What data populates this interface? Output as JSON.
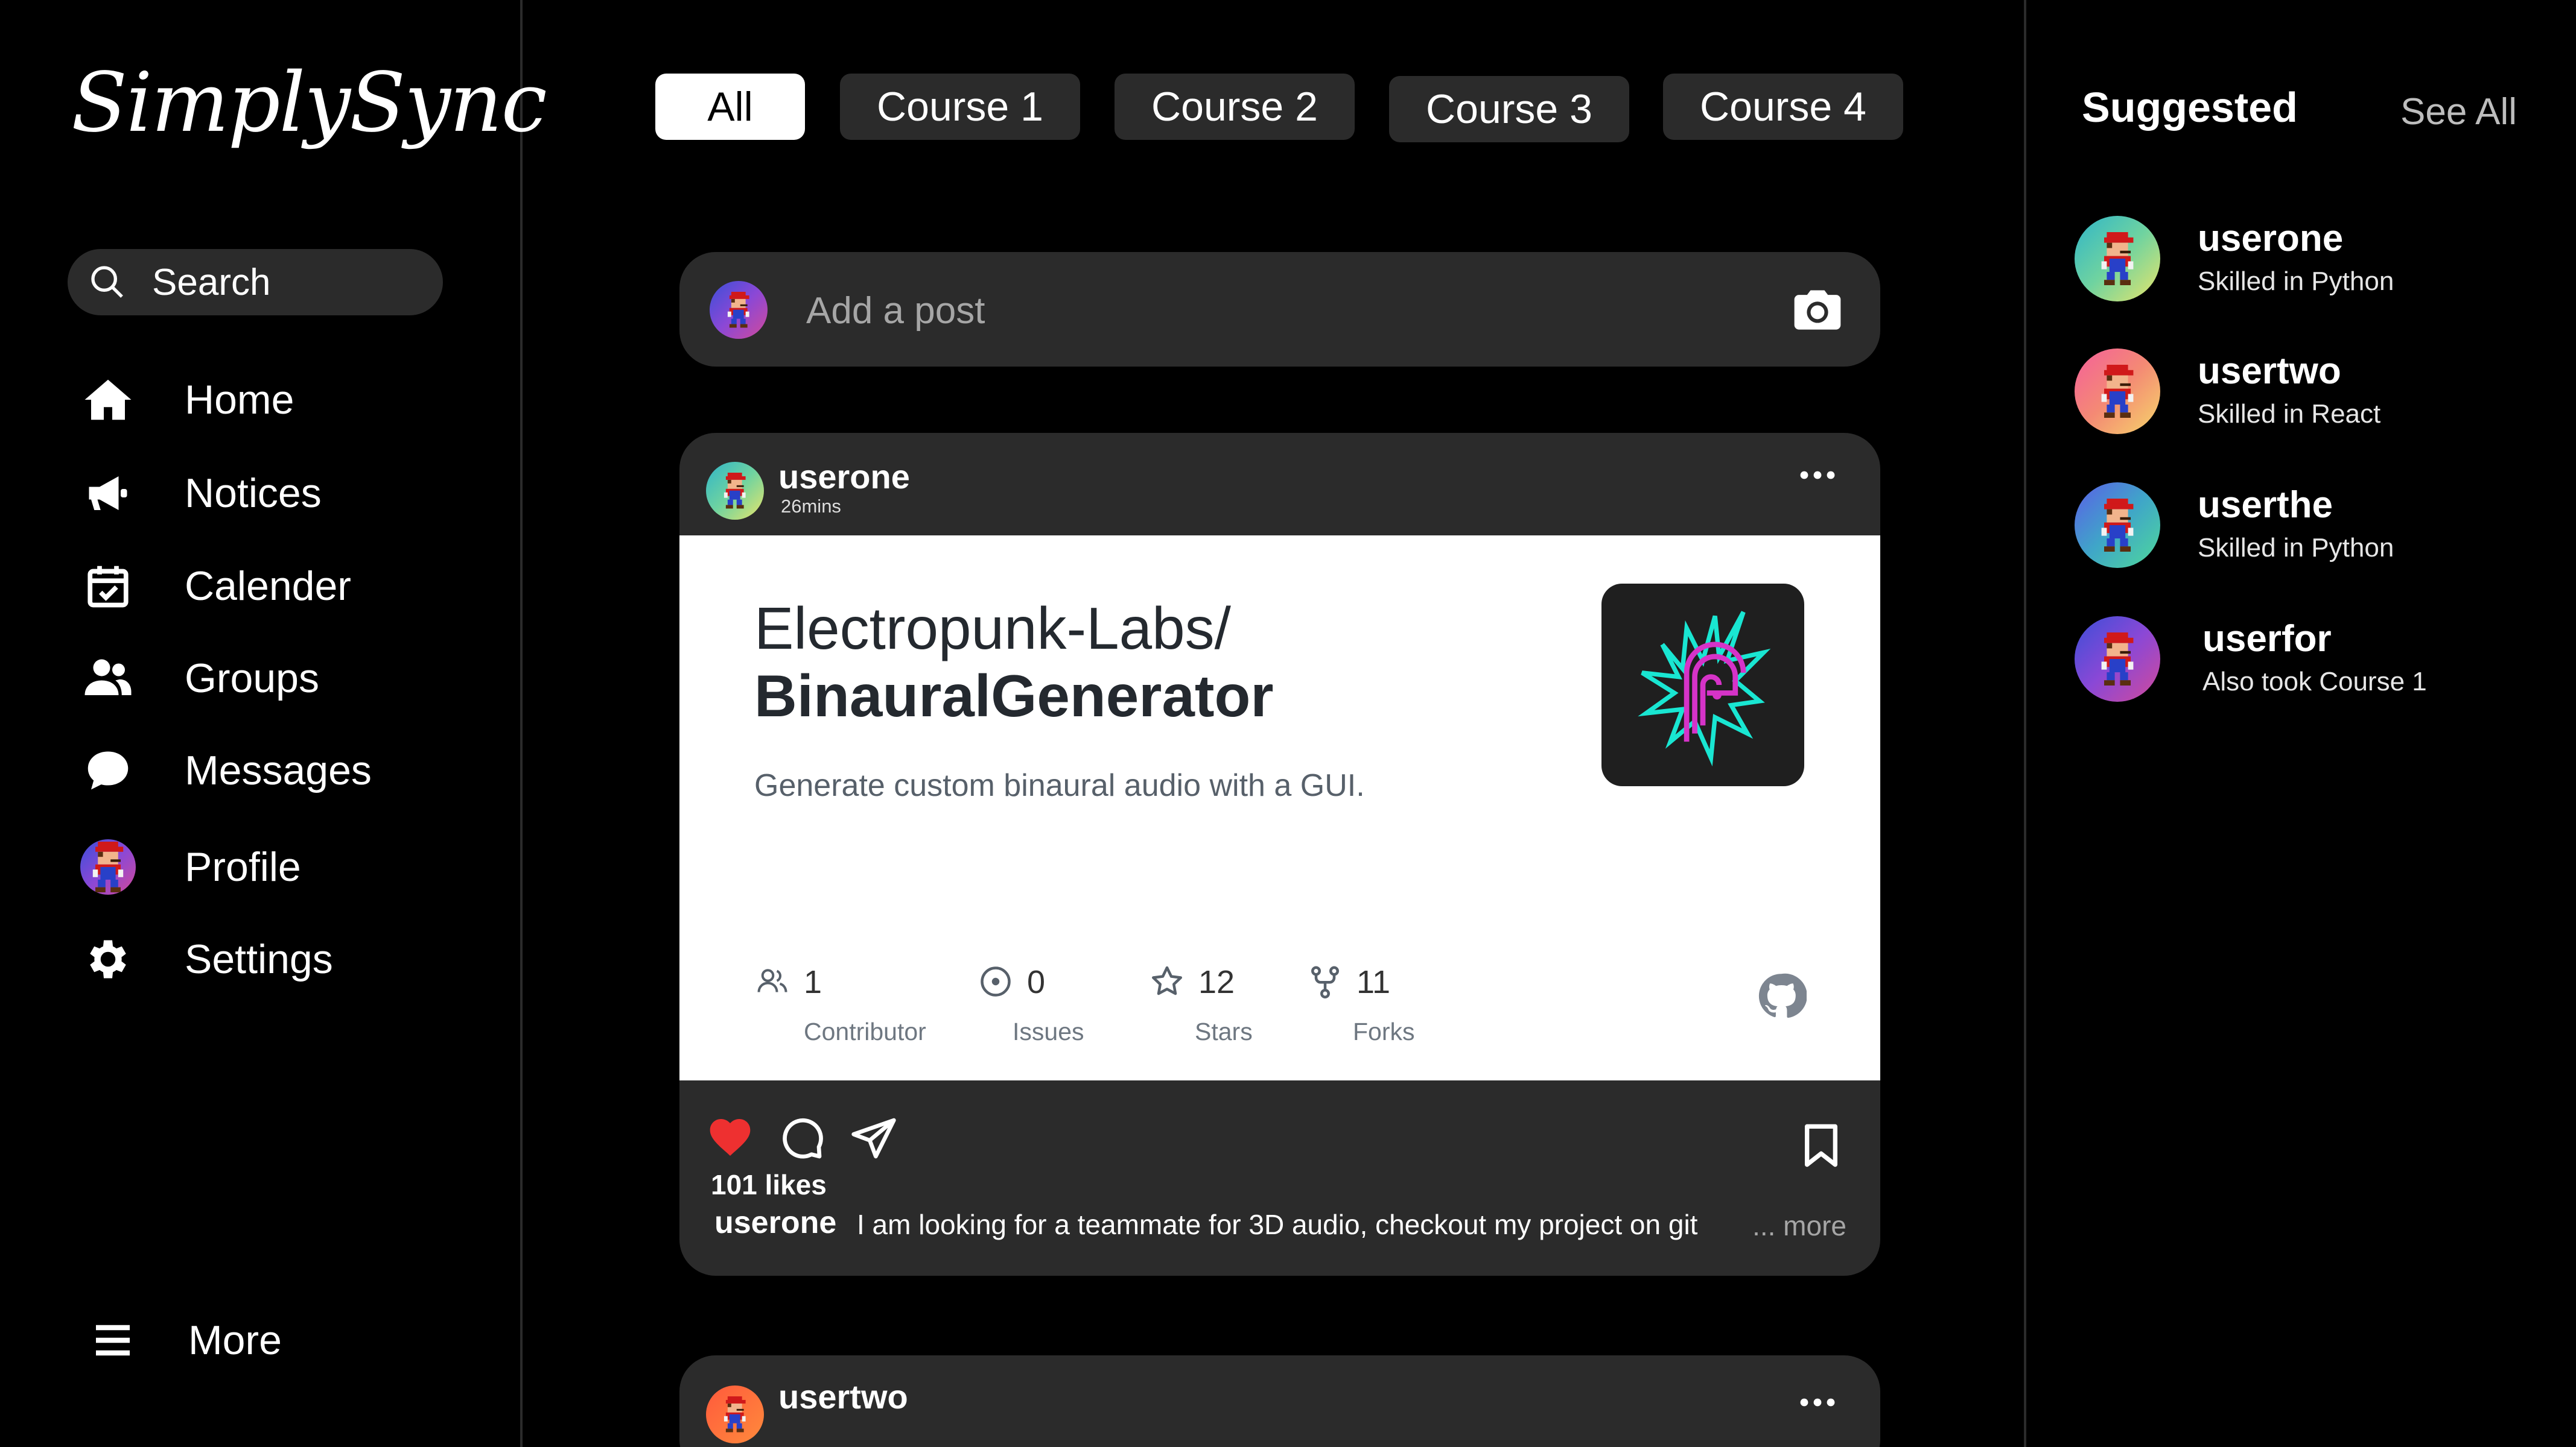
{
  "app": {
    "logo": "SimplySync"
  },
  "sidebar": {
    "search_label": "Search",
    "items": [
      {
        "label": "Home",
        "icon": "home-icon"
      },
      {
        "label": "Notices",
        "icon": "megaphone-icon"
      },
      {
        "label": "Calender",
        "icon": "calendar-icon"
      },
      {
        "label": "Groups",
        "icon": "groups-icon"
      },
      {
        "label": "Messages",
        "icon": "chat-bubble-icon"
      },
      {
        "label": "Profile",
        "icon": "avatar"
      },
      {
        "label": "Settings",
        "icon": "gear-icon"
      }
    ],
    "more_label": "More"
  },
  "tabs": [
    {
      "label": "All",
      "active": true
    },
    {
      "label": "Course 1",
      "active": false
    },
    {
      "label": "Course 2",
      "active": false
    },
    {
      "label": "Course 3",
      "active": false
    },
    {
      "label": "Course 4",
      "active": false
    }
  ],
  "composer": {
    "placeholder": "Add a post"
  },
  "posts": [
    {
      "user": "userone",
      "time": "26mins",
      "card": {
        "repo_owner": "Electropunk-Labs/",
        "repo_name": "BinauralGenerator",
        "description": "Generate custom binaural audio with a GUI.",
        "stats": [
          {
            "value": "1",
            "label": "Contributor",
            "icon": "contributors-icon"
          },
          {
            "value": "0",
            "label": "Issues",
            "icon": "issue-icon"
          },
          {
            "value": "12",
            "label": "Stars",
            "icon": "star-icon"
          },
          {
            "value": "11",
            "label": "Forks",
            "icon": "fork-icon"
          }
        ]
      },
      "likes": "101 likes",
      "caption_user": "userone",
      "caption": "I am looking for a teammate for 3D audio, checkout my project on git",
      "more": "... more"
    },
    {
      "user": "usertwo"
    }
  ],
  "suggested": {
    "title": "Suggested",
    "see_all": "See All",
    "users": [
      {
        "name": "userone",
        "sub": "Skilled in Python"
      },
      {
        "name": "usertwo",
        "sub": "Skilled in React"
      },
      {
        "name": "userthe",
        "sub": "Skilled in Python"
      },
      {
        "name": "userfor",
        "sub": "Also took Course 1"
      }
    ]
  },
  "colors": {
    "background": "#000000",
    "panel": "#2b2b2b",
    "like_red": "#ee3030",
    "card_bg": "#ffffff",
    "neon_cyan": "#19e6d2",
    "neon_magenta": "#d633c8"
  }
}
